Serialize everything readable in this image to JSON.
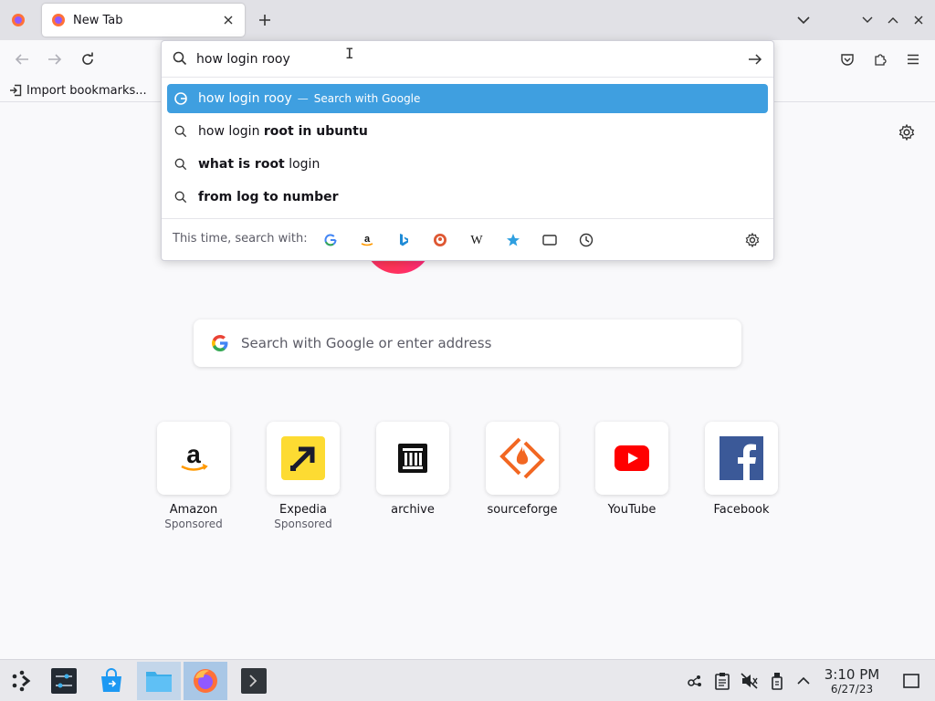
{
  "tab": {
    "title": "New Tab"
  },
  "urlbar": {
    "value": "how login rooy",
    "suggestions": [
      {
        "query": "how login rooy",
        "action": "Search with Google",
        "separator": "—"
      },
      {
        "prefix": "how login ",
        "bold": "root in ubuntu",
        "suffix": ""
      },
      {
        "prefix": "",
        "bold": "what is root",
        "suffix": " login"
      },
      {
        "prefix": "",
        "bold": "from log to number",
        "suffix": ""
      }
    ],
    "oneoff_label": "This time, search with:",
    "oneoff_engines": [
      "google-icon",
      "amazon-icon",
      "bing-icon",
      "duckduckgo-icon",
      "wikipedia-icon",
      "bookmarks-icon",
      "tabs-icon",
      "history-icon"
    ]
  },
  "bookmarks": {
    "import_label": "Import bookmarks..."
  },
  "newtab": {
    "search_placeholder": "Search with Google or enter address",
    "topsites": [
      {
        "title": "Amazon",
        "sponsored": "Sponsored"
      },
      {
        "title": "Expedia",
        "sponsored": "Sponsored"
      },
      {
        "title": "archive",
        "sponsored": ""
      },
      {
        "title": "sourceforge",
        "sponsored": ""
      },
      {
        "title": "YouTube",
        "sponsored": ""
      },
      {
        "title": "Facebook",
        "sponsored": ""
      }
    ]
  },
  "taskbar": {
    "clock_time": "3:10 PM",
    "clock_date": "6/27/23"
  },
  "colors": {
    "selected_suggestion": "#3f9fe0",
    "firefox_orange": "#ff7139",
    "youtube_red": "#ff0000",
    "facebook_blue": "#3b5998",
    "expedia_yellow": "#fddb32",
    "sourceforge_orange": "#f26722"
  }
}
